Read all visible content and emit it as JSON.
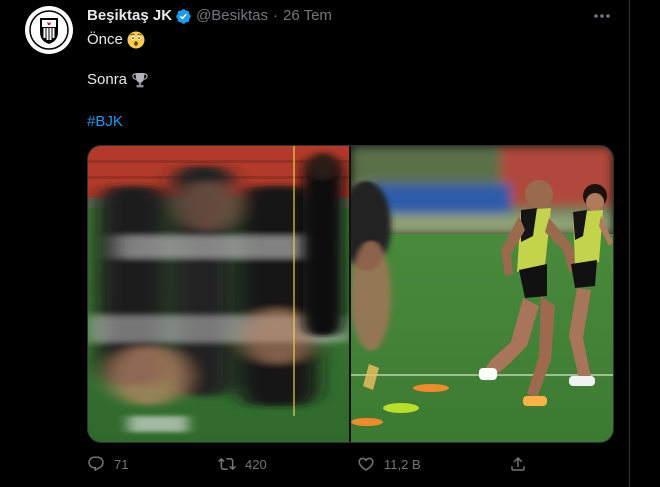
{
  "tweet": {
    "display_name": "Beşiktaş JK",
    "handle": "@Besiktas",
    "separator": "·",
    "date": "26 Tem",
    "line1": "Önce",
    "line2": "Sonra",
    "hashtag": "#BJK"
  },
  "avatar": {
    "logo_text_top": "BJK",
    "logo_text_bottom": "1903"
  },
  "actions": {
    "reply_count": "71",
    "retweet_count": "420",
    "like_count": "11,2 B"
  },
  "colors": {
    "background": "#000000",
    "text": "#e7e9ea",
    "muted": "#71767b",
    "accent": "#1d9bf0",
    "border": "#2f3336"
  },
  "icons": {
    "verified": "verified-badge-icon",
    "more": "more-dots-icon",
    "emoji1": "astonished-face-icon",
    "emoji2": "trophy-icon",
    "reply": "reply-icon",
    "retweet": "retweet-icon",
    "like": "heart-icon",
    "share": "share-icon"
  }
}
